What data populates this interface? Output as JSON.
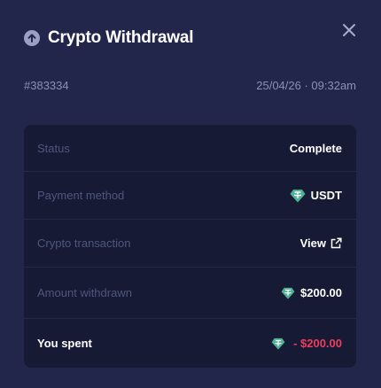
{
  "header": {
    "title": "Crypto Withdrawal",
    "icon": "arrow-up-circle-icon",
    "close_icon": "close-icon"
  },
  "meta": {
    "id": "#383334",
    "datetime": "25/04/26 · 09:32am"
  },
  "details": {
    "status": {
      "label": "Status",
      "value": "Complete"
    },
    "payment_method": {
      "label": "Payment method",
      "value": "USDT",
      "icon": "usdt-icon"
    },
    "crypto_transaction": {
      "label": "Crypto transaction",
      "value": "View",
      "icon": "external-link-icon"
    },
    "amount_withdrawn": {
      "label": "Amount withdrawn",
      "value": "$200.00",
      "icon": "usdt-icon"
    },
    "you_spent": {
      "label": "You spent",
      "value": "- $200.00",
      "icon": "usdt-icon"
    }
  },
  "colors": {
    "background": "#22264a",
    "card": "#161a35",
    "negative": "#ee3e5c",
    "usdt": "#50af95"
  }
}
